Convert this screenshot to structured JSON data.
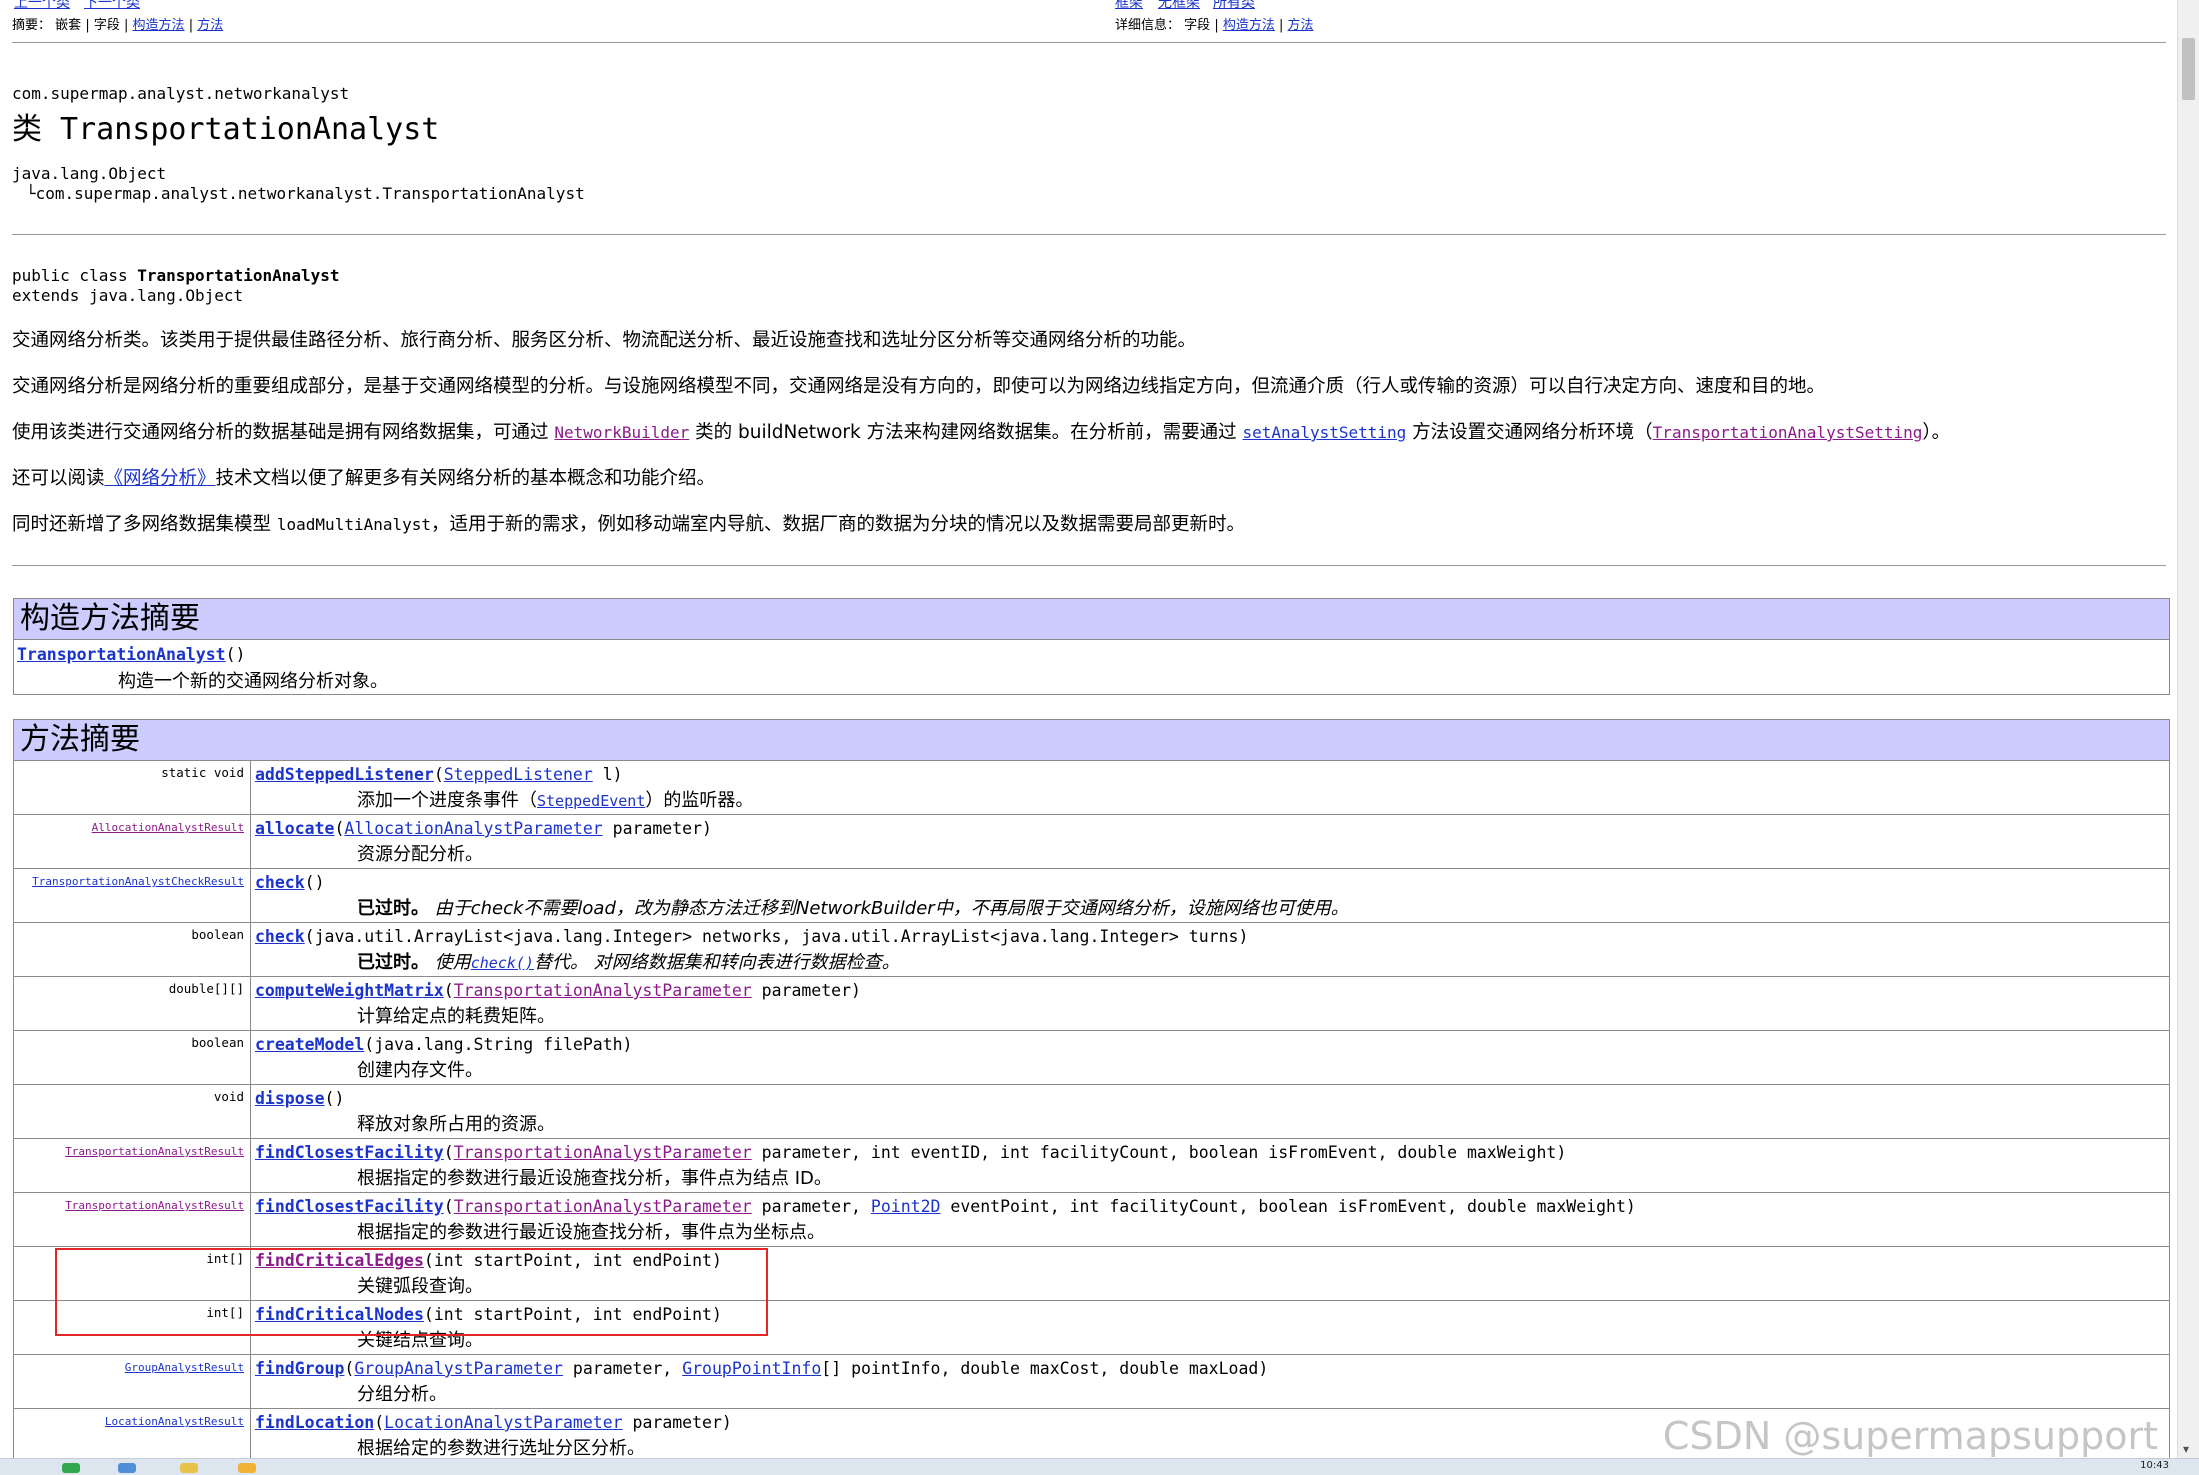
{
  "topnav": {
    "left_fragment_1": "上一个类",
    "left_fragment_2": "下一个类",
    "right_fragment_1": "框架",
    "right_fragment_2": "无框架",
    "right_fragment_3": "所有类",
    "summary_label": "摘要：",
    "summary_nested": "嵌套",
    "summary_field": "字段",
    "summary_constructor": "构造方法",
    "summary_method": "方法",
    "detail_label": "详细信息：",
    "detail_field": "字段",
    "detail_constructor": "构造方法",
    "detail_method": "方法",
    "sep": "|"
  },
  "header": {
    "package": "com.supermap.analyst.networkanalyst",
    "title": "类 TransportationAnalyst",
    "hierarchy_root": "java.lang.Object",
    "hierarchy_child": "└com.supermap.analyst.networkanalyst.TransportationAnalyst",
    "decl_line1_prefix": "public class ",
    "decl_line1_name": "TransportationAnalyst",
    "decl_line2": "extends java.lang.Object"
  },
  "description": {
    "p1": "交通网络分析类。该类用于提供最佳路径分析、旅行商分析、服务区分析、物流配送分析、最近设施查找和选址分区分析等交通网络分析的功能。",
    "p2": "交通网络分析是网络分析的重要组成部分，是基于交通网络模型的分析。与设施网络模型不同，交通网络是没有方向的，即使可以为网络边线指定方向，但流通介质（行人或传输的资源）可以自行决定方向、速度和目的地。",
    "p3_a": "使用该类进行交通网络分析的数据基础是拥有网络数据集，可通过 ",
    "p3_link1": "NetworkBuilder",
    "p3_b": " 类的 buildNetwork 方法来构建网络数据集。在分析前，需要通过 ",
    "p3_link2": "setAnalystSetting",
    "p3_c": " 方法设置交通网络分析环境（",
    "p3_link3": "TransportationAnalystSetting",
    "p3_d": "）。",
    "p4_a": "还可以阅读",
    "p4_link": "《网络分析》",
    "p4_b": "技术文档以便了解更多有关网络分析的基本概念和功能介绍。",
    "p5_a": "同时还新增了多网络数据集模型 ",
    "p5_code": "loadMultiAnalyst",
    "p5_b": "，适用于新的需求，例如移动端室内导航、数据厂商的数据为分块的情况以及数据需要局部更新时。"
  },
  "constructor_summary": {
    "heading": "构造方法摘要",
    "name": "TransportationAnalyst",
    "params": "()",
    "desc": "构造一个新的交通网络分析对象。"
  },
  "method_summary": {
    "heading": "方法摘要",
    "rows": [
      {
        "type": "static void",
        "name": "addSteppedListener",
        "p1": "(",
        "l1": "SteppedListener",
        "p2": " l)",
        "d1": "添加一个进度条事件（",
        "dl": "SteppedEvent",
        "d2": "）的监听器。"
      },
      {
        "type": "AllocationAnalystResult",
        "name": "allocate",
        "p1": "(",
        "l1": "AllocationAnalystParameter",
        "p2": " parameter)",
        "d1": "资源分配分析。"
      },
      {
        "type": "TransportationAnalystCheckResult",
        "name": "check",
        "p1": "()",
        "dep": "已过时。",
        "d1": " 由于check不需要load，改为静态方法迁移到NetworkBuilder中，不再局限于交通网络分析，设施网络也可使用。"
      },
      {
        "type": "boolean",
        "name": "check",
        "p1": "(java.util.ArrayList<java.lang.Integer> networks, java.util.ArrayList<java.lang.Integer> turns)",
        "dep": "已过时。",
        "d1": " 使用",
        "dl": "check()",
        "d2": "替代。 对网络数据集和转向表进行数据检查。"
      },
      {
        "type": "double[][]",
        "name": "computeWeightMatrix",
        "p1": "(",
        "l1": "TransportationAnalystParameter",
        "p2": " parameter)",
        "d1": "计算给定点的耗费矩阵。"
      },
      {
        "type": "boolean",
        "name": "createModel",
        "p1": "(java.lang.String filePath)",
        "d1": "创建内存文件。"
      },
      {
        "type": "void",
        "name": "dispose",
        "p1": "()",
        "d1": "释放对象所占用的资源。"
      },
      {
        "type": "TransportationAnalystResult",
        "name": "findClosestFacility",
        "p1": "(",
        "l1": "TransportationAnalystParameter",
        "p2": " parameter, int eventID, int facilityCount, boolean isFromEvent, double maxWeight)",
        "d1": "根据指定的参数进行最近设施查找分析，事件点为结点 ID。"
      },
      {
        "type": "TransportationAnalystResult",
        "name": "findClosestFacility",
        "p1": "(",
        "l1": "TransportationAnalystParameter",
        "p2": " parameter, ",
        "l2": "Point2D",
        "p3": " eventPoint, int facilityCount, boolean isFromEvent, double maxWeight)",
        "d1": "根据指定的参数进行最近设施查找分析，事件点为坐标点。"
      },
      {
        "type": "int[]",
        "name": "findCriticalEdges",
        "p1": "(int startPoint, int endPoint)",
        "d1": "关键弧段查询。"
      },
      {
        "type": "int[]",
        "name": "findCriticalNodes",
        "p1": "(int startPoint, int endPoint)",
        "d1": "关键结点查询。"
      },
      {
        "type": "GroupAnalystResult",
        "name": "findGroup",
        "p1": "(",
        "l1": "GroupAnalystParameter",
        "p2": " parameter, ",
        "l2": "GroupPointInfo",
        "p3": "[] pointInfo, double maxCost, double maxLoad)",
        "d1": "分组分析。"
      },
      {
        "type": "LocationAnalystResult",
        "name": "findLocation",
        "p1": "(",
        "l1": "LocationAnalystParameter",
        "p2": " parameter)",
        "d1": "根据给定的参数进行选址分区分析。"
      }
    ]
  },
  "watermark": "CSDN @supermapsupport",
  "taskbar": {
    "clock": "10:43"
  },
  "colors": {
    "link": "#1a33cc",
    "visited": "#8b1a8b",
    "table_header": "#ccccff",
    "highlight": "#e32626"
  }
}
